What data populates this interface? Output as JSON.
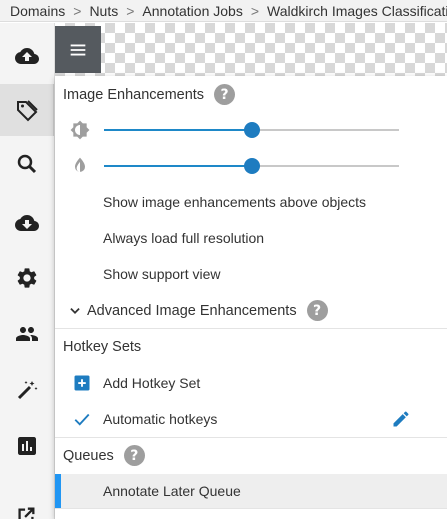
{
  "breadcrumb": {
    "items": [
      "Domains",
      "Nuts",
      "Annotation Jobs",
      "Waldkirch Images Classification"
    ],
    "separator": ">"
  },
  "rail": {
    "items": [
      {
        "icon": "cloud-upload-icon"
      },
      {
        "icon": "tag-icon",
        "active": true
      },
      {
        "icon": "search-icon"
      },
      {
        "icon": "cloud-download-icon"
      },
      {
        "icon": "gear-icon"
      },
      {
        "icon": "people-icon"
      },
      {
        "icon": "magic-wand-icon"
      },
      {
        "icon": "bar-chart-icon"
      },
      {
        "icon": "open-external-icon"
      }
    ]
  },
  "menu": {
    "icon": "hamburger-menu-icon"
  },
  "image_enhancements": {
    "title": "Image Enhancements",
    "help": "?",
    "brightness_level": 0.5,
    "contrast_level": 0.5,
    "options": [
      "Show image enhancements above objects",
      "Always load full resolution",
      "Show support view"
    ],
    "advanced_label": "Advanced Image Enhancements",
    "advanced_help": "?"
  },
  "hotkey_sets": {
    "title": "Hotkey Sets",
    "add_label": "Add Hotkey Set",
    "automatic_label": "Automatic hotkeys"
  },
  "queues": {
    "title": "Queues",
    "help": "?",
    "items": [
      "Annotate Later Queue"
    ]
  },
  "colors": {
    "accent": "#1e88c8",
    "menu_button": "#555a5f",
    "help_icon": "#9e9e9e"
  }
}
